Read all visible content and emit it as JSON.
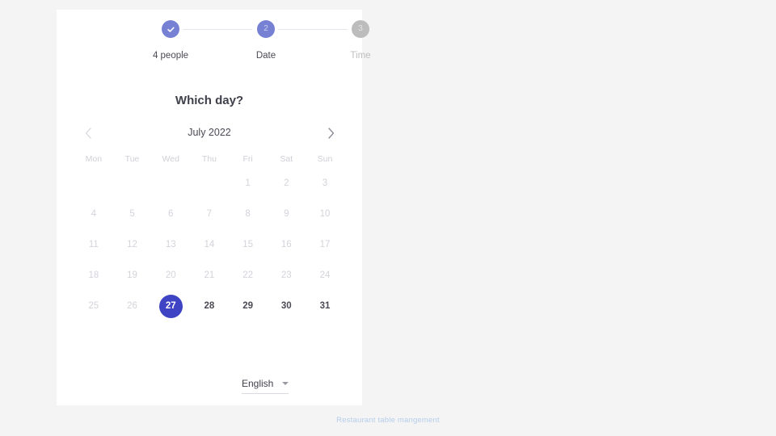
{
  "colors": {
    "page_bg": "#f4f4f5",
    "card_bg": "#ffffff",
    "step_active": "#7781d4",
    "step_inactive": "#bcbcbc",
    "selected_day": "#3f44c4",
    "text_dark": "#4a4a55",
    "text_muted": "#d3d3da",
    "footer": "#b5cdea"
  },
  "stepper": {
    "steps": [
      {
        "label": "4 people",
        "indicator": "check-icon",
        "state": "done"
      },
      {
        "label": "Date",
        "indicator": "2",
        "state": "current"
      },
      {
        "label": "Time",
        "indicator": "3",
        "state": "upcoming"
      }
    ]
  },
  "main": {
    "title": "Which day?"
  },
  "calendar": {
    "month_label": "July 2022",
    "prev_label": "‹",
    "next_label": "›",
    "weekdays": [
      "Mon",
      "Tue",
      "Wed",
      "Thu",
      "Fri",
      "Sat",
      "Sun"
    ],
    "selected_day": 27,
    "weeks": [
      [
        {
          "day": "",
          "state": "empty"
        },
        {
          "day": "",
          "state": "empty"
        },
        {
          "day": "",
          "state": "empty"
        },
        {
          "day": "",
          "state": "empty"
        },
        {
          "day": "1",
          "state": "disabled"
        },
        {
          "day": "2",
          "state": "disabled"
        },
        {
          "day": "3",
          "state": "disabled"
        }
      ],
      [
        {
          "day": "4",
          "state": "disabled"
        },
        {
          "day": "5",
          "state": "disabled"
        },
        {
          "day": "6",
          "state": "disabled"
        },
        {
          "day": "7",
          "state": "disabled"
        },
        {
          "day": "8",
          "state": "disabled"
        },
        {
          "day": "9",
          "state": "disabled"
        },
        {
          "day": "10",
          "state": "disabled"
        }
      ],
      [
        {
          "day": "11",
          "state": "disabled"
        },
        {
          "day": "12",
          "state": "disabled"
        },
        {
          "day": "13",
          "state": "disabled"
        },
        {
          "day": "14",
          "state": "disabled"
        },
        {
          "day": "15",
          "state": "disabled"
        },
        {
          "day": "16",
          "state": "disabled"
        },
        {
          "day": "17",
          "state": "disabled"
        }
      ],
      [
        {
          "day": "18",
          "state": "disabled"
        },
        {
          "day": "19",
          "state": "disabled"
        },
        {
          "day": "20",
          "state": "disabled"
        },
        {
          "day": "21",
          "state": "disabled"
        },
        {
          "day": "22",
          "state": "disabled"
        },
        {
          "day": "23",
          "state": "disabled"
        },
        {
          "day": "24",
          "state": "disabled"
        }
      ],
      [
        {
          "day": "25",
          "state": "disabled"
        },
        {
          "day": "26",
          "state": "disabled"
        },
        {
          "day": "27",
          "state": "selected"
        },
        {
          "day": "28",
          "state": "active"
        },
        {
          "day": "29",
          "state": "active"
        },
        {
          "day": "30",
          "state": "active"
        },
        {
          "day": "31",
          "state": "active"
        }
      ]
    ]
  },
  "language": {
    "value": "English",
    "caret": "chevron-down-icon"
  },
  "footer": {
    "text": "Restaurant table mangement"
  }
}
